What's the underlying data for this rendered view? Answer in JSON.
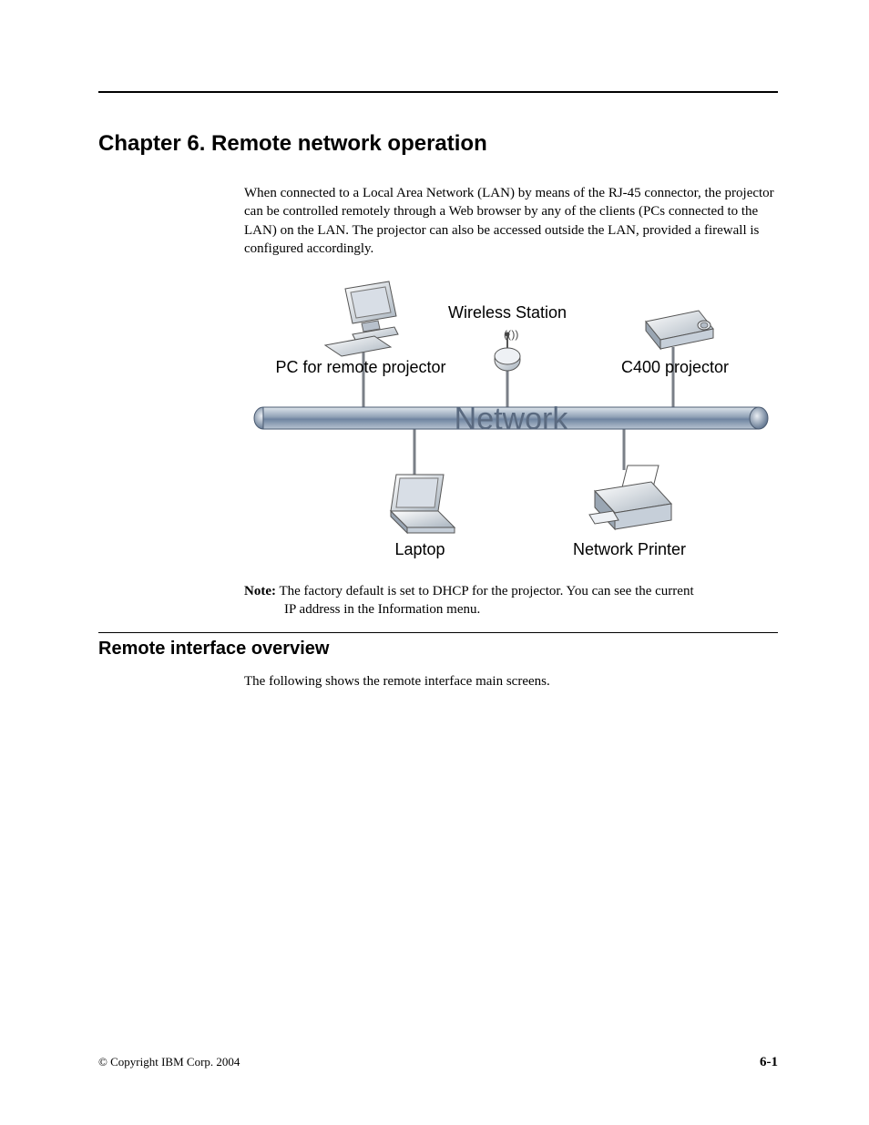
{
  "chapter": {
    "title": "Chapter 6. Remote network operation",
    "intro": "When connected to a Local Area Network (LAN) by means of the RJ-45 connector, the projector can be controlled remotely through a Web browser by any of the clients (PCs connected to the LAN) on the LAN. The projector can also be accessed outside the LAN, provided a firewall is configured accordingly."
  },
  "diagram": {
    "pc_label": "PC for remote projector",
    "wireless_label": "Wireless Station",
    "projector_label": "C400 projector",
    "network_label": "Network",
    "laptop_label": "Laptop",
    "printer_label": "Network Printer"
  },
  "note": {
    "label": "Note:",
    "body_line1": "The factory default is set to DHCP for the projector. You can see the current",
    "body_line2": "IP address in the Information menu."
  },
  "section": {
    "heading": "Remote interface overview",
    "para": "The following shows the remote interface main screens."
  },
  "footer": {
    "copyright": "© Copyright IBM Corp. 2004",
    "page": "6-1"
  }
}
